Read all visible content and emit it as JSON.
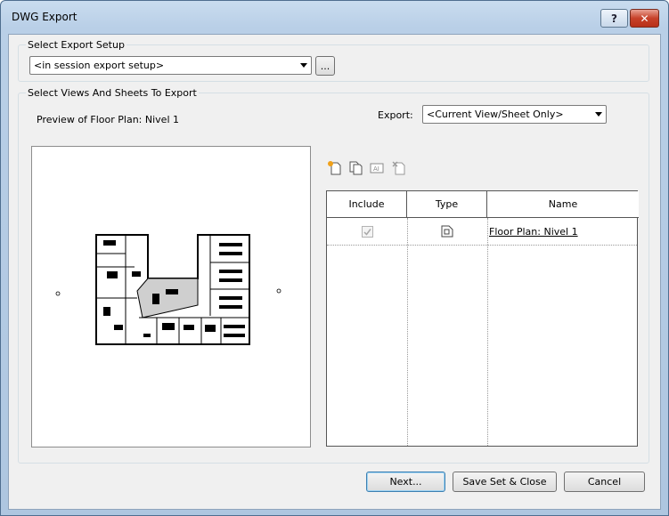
{
  "window": {
    "title": "DWG Export"
  },
  "export_setup": {
    "group_label": "Select Export Setup",
    "selected": "<in session export setup>",
    "browse_label": "..."
  },
  "views": {
    "group_label": "Select Views And Sheets To Export",
    "preview_label": "Preview of Floor Plan: Nivel 1",
    "export_label": "Export:",
    "export_selected": "<Current View/Sheet Only>"
  },
  "toolbar": {
    "icons": [
      "new-sheet-set-icon",
      "duplicate-set-icon",
      "rename-set-icon",
      "delete-set-icon"
    ]
  },
  "table": {
    "columns": [
      "Include",
      "Type",
      "Name"
    ],
    "rows": [
      {
        "include": true,
        "type_icon": "floor-plan-view-icon",
        "name": "Floor Plan: Nivel 1"
      }
    ]
  },
  "buttons": {
    "next": "Next...",
    "save_close": "Save Set & Close",
    "cancel": "Cancel"
  }
}
